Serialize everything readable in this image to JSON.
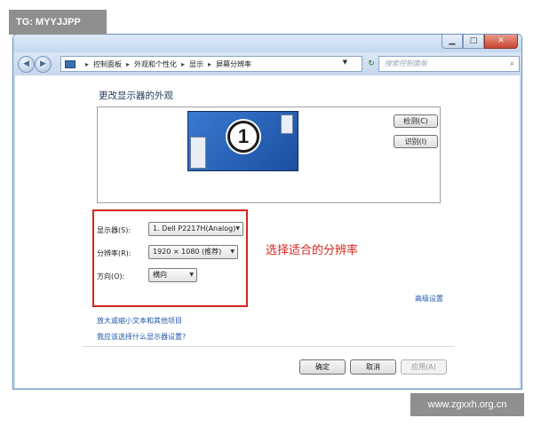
{
  "watermarks": {
    "top_left": "TG: MYYJJPP",
    "bottom_right": "www.zgxxh.org.cn"
  },
  "window": {
    "caption_buttons": {
      "minimize": "▁",
      "maximize": "□",
      "close": "✕"
    }
  },
  "navigation": {
    "back": "◀",
    "forward": "▶",
    "breadcrumb": [
      "控制面板",
      "外观和个性化",
      "显示",
      "屏幕分辨率"
    ],
    "separator": "▸",
    "dropdown_glyph": "▼",
    "refresh_glyph": "↻",
    "search_placeholder": "搜索控制面板",
    "search_icon": "⌕"
  },
  "page": {
    "title": "更改显示器的外观"
  },
  "preview": {
    "monitor_number": "1",
    "detect_label": "检测(C)",
    "identify_label": "识别(I)"
  },
  "settings": {
    "display_label": "显示器(S):",
    "display_value": "1. Dell P2217H(Analog)",
    "resolution_label": "分辨率(R):",
    "resolution_value": "1920 × 1080 (推荐)",
    "orientation_label": "方向(O):",
    "orientation_value": "横向",
    "dropdown_arrow": "▼"
  },
  "annotation": {
    "text": "选择适合的分辨率",
    "color": "#d4261f"
  },
  "links": {
    "advanced": "高级设置",
    "enlarge_text": "放大或缩小文本和其他项目",
    "which_settings": "我应该选择什么显示器设置?"
  },
  "footer": {
    "ok_label": "确定",
    "cancel_label": "取消",
    "apply_label": "应用(A)"
  }
}
